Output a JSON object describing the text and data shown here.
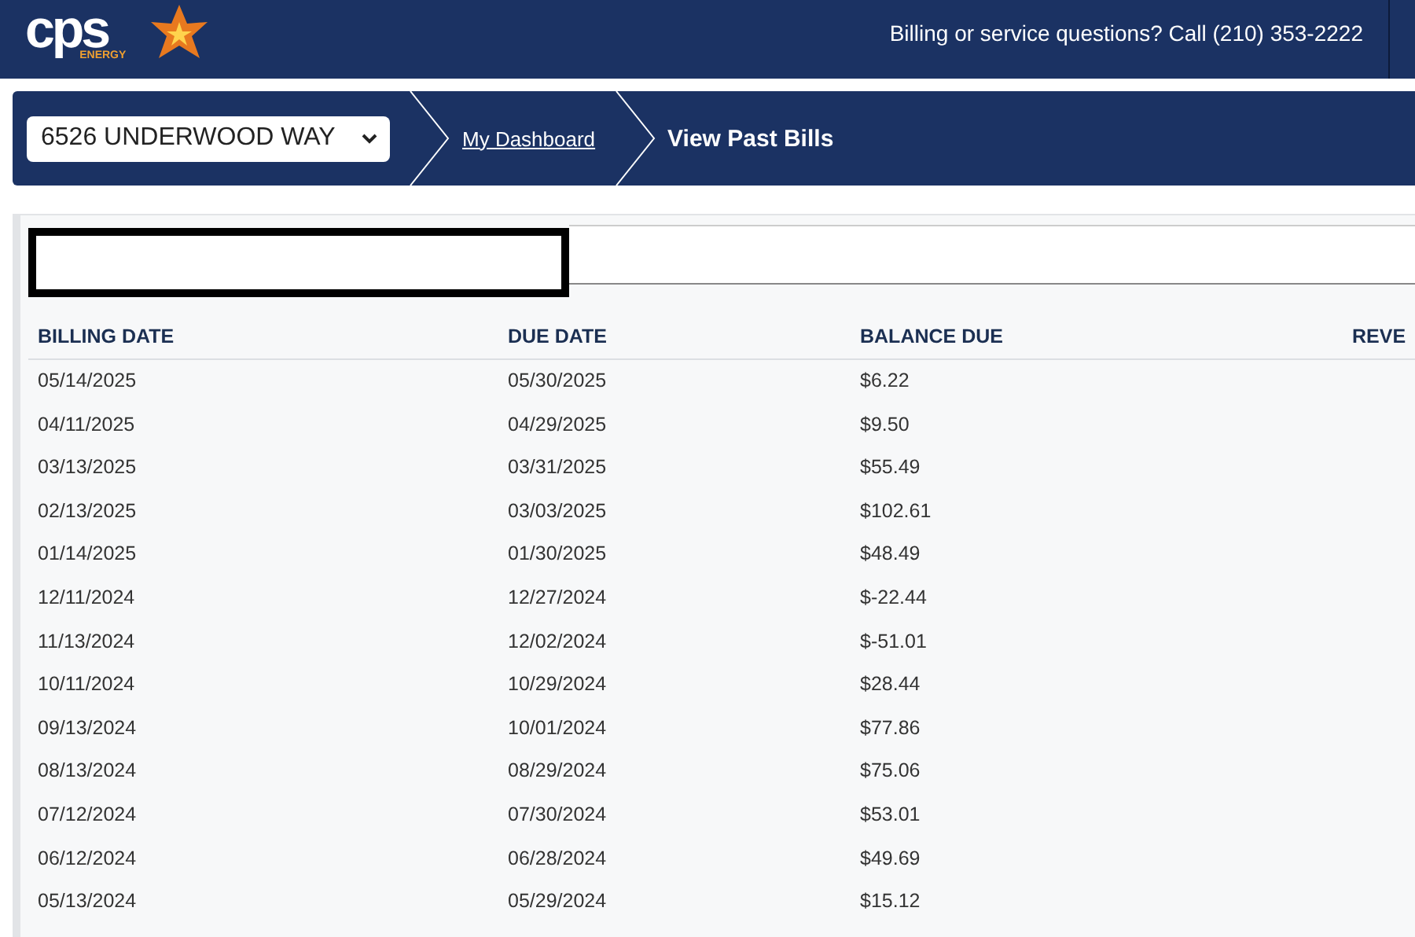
{
  "header": {
    "logo": {
      "wordmark": "cps",
      "subtitle": "ENERGY"
    },
    "help_text": "Billing or service questions? Call (210) 353-2222"
  },
  "breadcrumb": {
    "address_select": {
      "value": "6526 UNDERWOOD WAY"
    },
    "items": [
      {
        "label": "My Dashboard",
        "kind": "link"
      },
      {
        "label": "View Past Bills",
        "kind": "current"
      }
    ]
  },
  "table": {
    "columns": [
      "BILLING DATE",
      "DUE DATE",
      "BALANCE DUE",
      "REVE"
    ],
    "rows": [
      [
        "05/14/2025",
        "05/30/2025",
        "$6.22"
      ],
      [
        "04/11/2025",
        "04/29/2025",
        "$9.50"
      ],
      [
        "03/13/2025",
        "03/31/2025",
        "$55.49"
      ],
      [
        "02/13/2025",
        "03/03/2025",
        "$102.61"
      ],
      [
        "01/14/2025",
        "01/30/2025",
        "$48.49"
      ],
      [
        "12/11/2024",
        "12/27/2024",
        "$-22.44"
      ],
      [
        "11/13/2024",
        "12/02/2024",
        "$-51.01"
      ],
      [
        "10/11/2024",
        "10/29/2024",
        "$28.44"
      ],
      [
        "09/13/2024",
        "10/01/2024",
        "$77.86"
      ],
      [
        "08/13/2024",
        "08/29/2024",
        "$75.06"
      ],
      [
        "07/12/2024",
        "07/30/2024",
        "$53.01"
      ],
      [
        "06/12/2024",
        "06/28/2024",
        "$49.69"
      ],
      [
        "05/13/2024",
        "05/29/2024",
        "$15.12"
      ]
    ]
  }
}
